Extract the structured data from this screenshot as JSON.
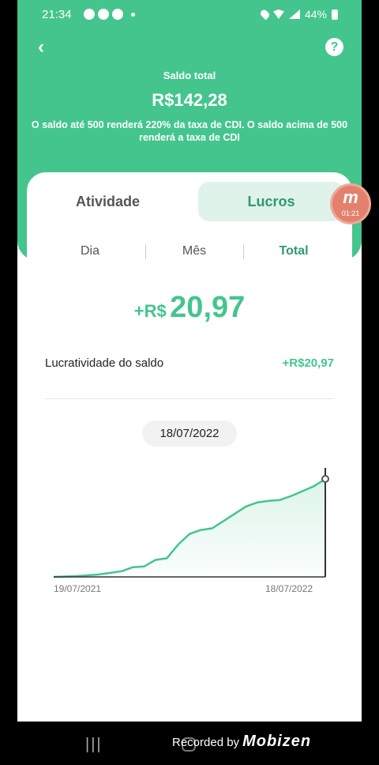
{
  "status_bar": {
    "time": "21:34",
    "battery": "44%"
  },
  "header": {
    "saldo_label": "Saldo total",
    "saldo_value": "R$142,28",
    "note": "O saldo até 500 renderá 220% da taxa de CDI. O saldo acima de 500 renderá a taxa de CDI"
  },
  "tabs": [
    {
      "label": "Atividade",
      "selected": false
    },
    {
      "label": "Lucros",
      "selected": true
    }
  ],
  "periods": [
    {
      "label": "Dia",
      "selected": false
    },
    {
      "label": "Mês",
      "selected": false
    },
    {
      "label": "Total",
      "selected": true
    }
  ],
  "recording_badge": {
    "time": "01:21"
  },
  "summary": {
    "currency": "+R$",
    "value": "20,97",
    "row_label": "Lucratividade do saldo",
    "row_value": "+R$20,97"
  },
  "chart": {
    "selected_date": "18/07/2022",
    "start_label": "19/07/2021",
    "end_label": "18/07/2022"
  },
  "chart_data": {
    "type": "area",
    "x": [
      "19/07/2021",
      "18/07/2022"
    ],
    "series": [
      {
        "values": [
          0.0,
          0.05,
          0.1,
          0.2,
          0.3,
          0.5,
          0.7,
          1.2,
          1.3,
          2.1,
          2.3,
          4.0,
          5.3,
          5.8,
          6.0,
          6.9,
          7.8,
          8.7,
          9.2,
          9.4,
          9.5,
          10.0,
          10.6,
          11.2,
          12.1
        ]
      }
    ],
    "color": "#44c58e",
    "grid": false
  },
  "watermark": {
    "prefix": "Recorded by",
    "brand": "Mobizen"
  },
  "colors": {
    "accent": "#44c58e",
    "tab_selected_bg": "#dff3ea"
  }
}
